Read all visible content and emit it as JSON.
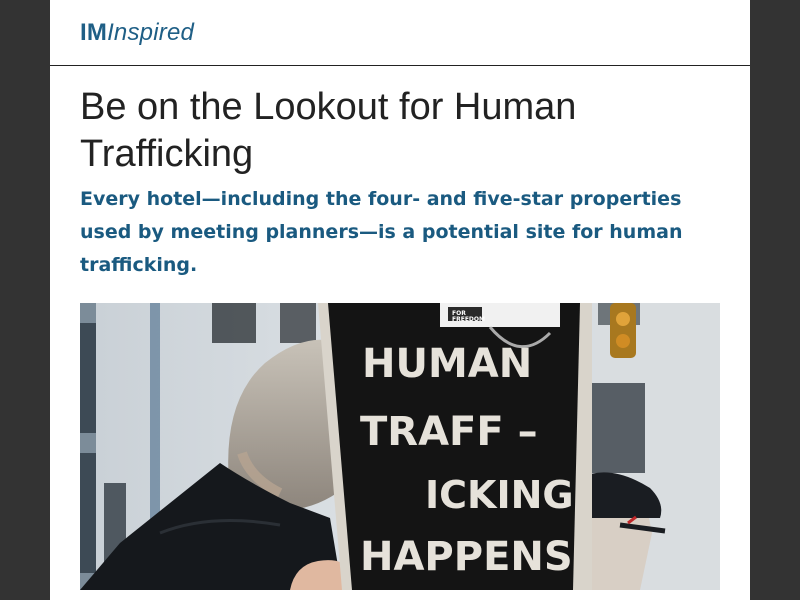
{
  "header": {
    "logo_bold": "IM",
    "logo_italic": "Inspired"
  },
  "article": {
    "title": "Be on the Lookout for Human Trafficking",
    "subtitle": "Every hotel—including the four- and five-star properties used by meeting planners—is a potential site for human trafficking."
  },
  "hero": {
    "sign_lines": [
      "HUMAN",
      "TRAFF –",
      "ICKING",
      "HAPPENS"
    ],
    "sticker_text": "FOR\nFREEDOM"
  },
  "colors": {
    "brand": "#1f5f86",
    "subtitle": "#1a5a80",
    "title": "#222222",
    "backdrop": "#333333"
  }
}
